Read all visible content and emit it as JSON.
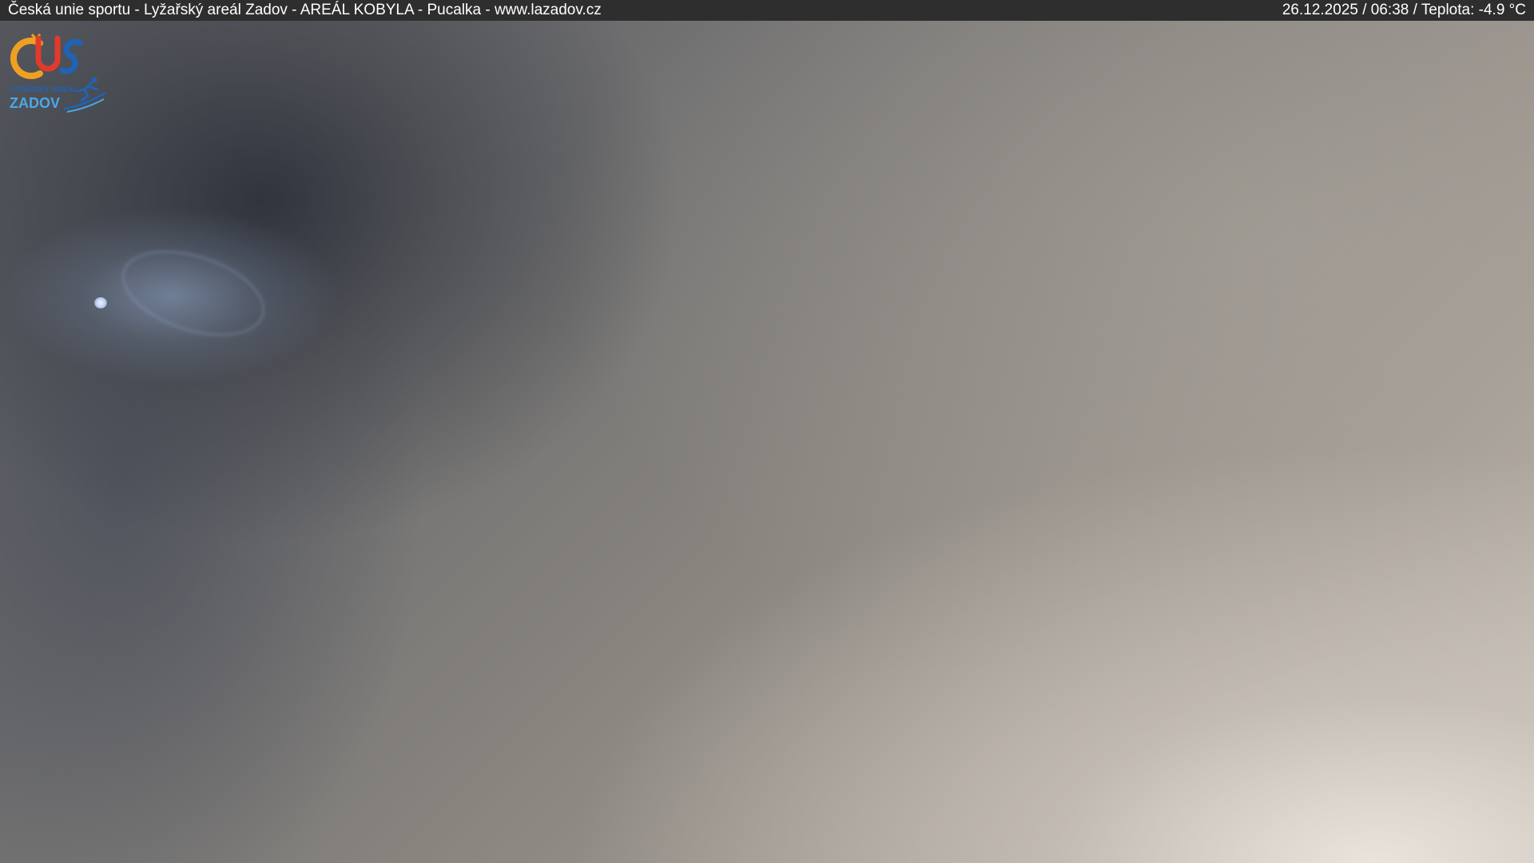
{
  "window": {
    "title": "Česká unie sportu - Lyžařský areál Zadov - AREÁL KOBYLA - Pucalka - www.lazadov.cz",
    "status": "26.12.2025 / 06:38 / Teplota: -4.9 °C"
  },
  "logo": {
    "emblem": "ČUS",
    "line1": "LYŽAŘSKÝ AREÁL",
    "line2": "ZADOV",
    "icon": "skier-icon",
    "colors": {
      "orange": "#f0a020",
      "blue": "#1f63b8",
      "light_blue": "#4aa8e8"
    }
  }
}
